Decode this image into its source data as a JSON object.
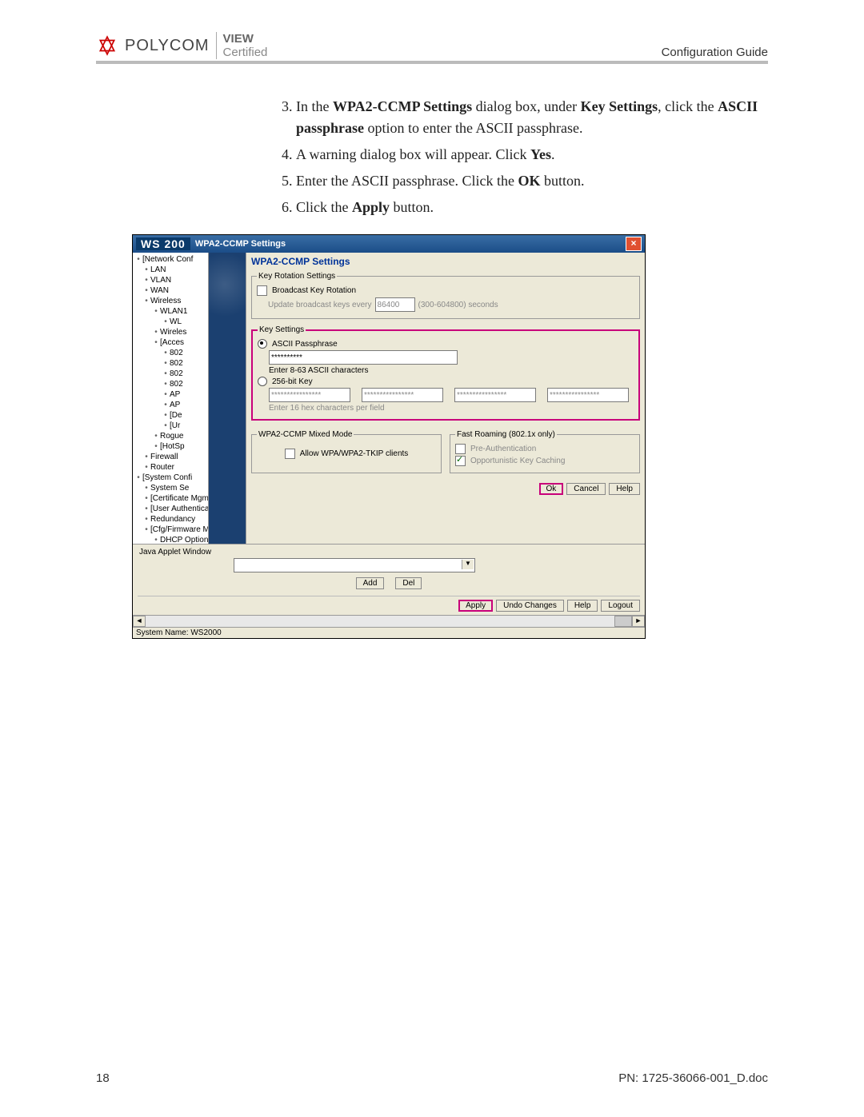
{
  "header": {
    "brand": "POLYCOM",
    "view": "VIEW",
    "certified": "Certified",
    "doc_title": "Configuration Guide"
  },
  "instructions": {
    "items": [
      {
        "n": "3.",
        "html": "In the <b>WPA2-CCMP Settings</b> dialog box, under <b>Key Settings</b>, click the <b>ASCII passphrase</b> option to enter the ASCII passphrase."
      },
      {
        "n": "4.",
        "html": "A warning dialog box will appear. Click <b>Yes</b>."
      },
      {
        "n": "5.",
        "html": "Enter the ASCII passphrase. Click the <b>OK</b> button."
      },
      {
        "n": "6.",
        "html": "Click the <b>Apply</b> button."
      }
    ]
  },
  "dialog": {
    "product": "WS 200",
    "title": "WPA2-CCMP Settings",
    "pane_title": "WPA2-CCMP Settings",
    "tree": [
      {
        "t": "[Network Conf",
        "l": 0
      },
      {
        "t": "LAN",
        "l": 1
      },
      {
        "t": "VLAN",
        "l": 1
      },
      {
        "t": "WAN",
        "l": 1
      },
      {
        "t": "Wireless",
        "l": 1
      },
      {
        "t": "WLAN1",
        "l": 2
      },
      {
        "t": "WL",
        "l": 3
      },
      {
        "t": "Wireles",
        "l": 2
      },
      {
        "t": "[Acces",
        "l": 2
      },
      {
        "t": "802",
        "l": 3
      },
      {
        "t": "802",
        "l": 3
      },
      {
        "t": "802",
        "l": 3
      },
      {
        "t": "802",
        "l": 3
      },
      {
        "t": "AP",
        "l": 3
      },
      {
        "t": "AP",
        "l": 3
      },
      {
        "t": "[De",
        "l": 3
      },
      {
        "t": "[Ur",
        "l": 3
      },
      {
        "t": "Rogue",
        "l": 2
      },
      {
        "t": "[HotSp",
        "l": 2
      },
      {
        "t": "Firewall",
        "l": 1
      },
      {
        "t": "Router",
        "l": 1
      },
      {
        "t": "[System Confi",
        "l": 0
      },
      {
        "t": "System Se",
        "l": 1
      },
      {
        "t": "[Certificate Mgmt.]",
        "l": 1
      },
      {
        "t": "[User Authentication]",
        "l": 1
      },
      {
        "t": "Redundancy",
        "l": 1
      },
      {
        "t": "[Cfg/Firmware Mgt.]",
        "l": 1
      },
      {
        "t": "DHCP Options ( Sys",
        "l": 2
      }
    ],
    "key_rotation": {
      "legend": "Key Rotation Settings",
      "broadcast_label": "Broadcast Key Rotation",
      "update_label": "Update broadcast keys every",
      "update_value": "86400",
      "update_hint": "(300-604800) seconds"
    },
    "key_settings": {
      "legend": "Key Settings",
      "ascii_label": "ASCII Passphrase",
      "ascii_value": "**********",
      "ascii_hint": "Enter 8-63 ASCII characters",
      "bit_label": "256-bit Key",
      "hex_value": "****************",
      "hex_hint": "Enter 16 hex characters per field"
    },
    "mixed_mode": {
      "legend": "WPA2-CCMP Mixed Mode",
      "allow_label": "Allow WPA/WPA2-TKIP clients"
    },
    "fast_roaming": {
      "legend": "Fast Roaming (802.1x only)",
      "preauth_label": "Pre-Authentication",
      "okc_label": "Opportunistic Key Caching"
    },
    "dlg_buttons": {
      "ok": "Ok",
      "cancel": "Cancel",
      "help": "Help"
    },
    "applet_label": "Java Applet Window",
    "mid_buttons": {
      "add": "Add",
      "del": "Del"
    },
    "bottom_buttons": {
      "apply": "Apply",
      "undo": "Undo Changes",
      "help": "Help",
      "logout": "Logout"
    },
    "status": "System Name: WS2000"
  },
  "footer": {
    "page": "18",
    "pn": "PN: 1725-36066-001_D.doc"
  }
}
